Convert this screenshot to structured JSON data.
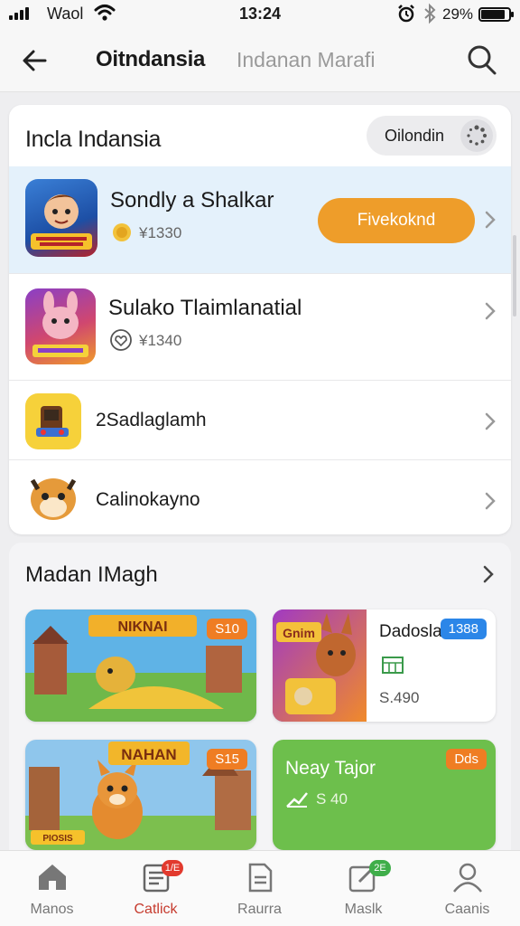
{
  "status_bar": {
    "carrier": "Waol",
    "time": "13:24",
    "battery": "29%"
  },
  "header": {
    "title": "Oitndansia",
    "subtitle": "Indanan Marafi",
    "back_icon": "arrow-left-icon",
    "search_icon": "search-icon"
  },
  "list_section": {
    "title": "Incla Indansia",
    "filter_label": "Oilondin",
    "items": [
      {
        "name": "Sondly a Shalkar",
        "meta": "¥1330",
        "action": "Fivekoknd",
        "highlighted": true
      },
      {
        "name": "Sulako Tlaimlanatial",
        "meta": "¥1340"
      },
      {
        "name": "2Sadlaglamh"
      },
      {
        "name": "Calinokayno"
      }
    ]
  },
  "grid_section": {
    "title": "Madan IMagh",
    "tiles": [
      {
        "banner": "NIKNAI",
        "tag": "S10"
      },
      {
        "banner": "Gnim",
        "title": "Dadoslar",
        "tag": "1388",
        "price": "S.490"
      },
      {
        "banner": "NAHAN",
        "caption": "PIOSIS",
        "tag": "S15"
      },
      {
        "title": "Neay Tajor",
        "tag": "Dds",
        "price": "S 40"
      }
    ]
  },
  "bottom_nav": {
    "items": [
      {
        "label": "Manos",
        "icon": "home-icon"
      },
      {
        "label": "Catlick",
        "icon": "catalog-icon",
        "badge": "1/E",
        "active": true
      },
      {
        "label": "Raurra",
        "icon": "document-icon"
      },
      {
        "label": "Maslk",
        "icon": "edit-icon",
        "badge": "2E"
      },
      {
        "label": "Caanis",
        "icon": "profile-icon"
      }
    ]
  },
  "colors": {
    "accent_orange": "#ee9d2a",
    "highlight_row": "#e4f1fb",
    "active_nav": "#c63b2e",
    "tag_blue": "#2b86e8",
    "tile_green": "#6dbf4c"
  }
}
